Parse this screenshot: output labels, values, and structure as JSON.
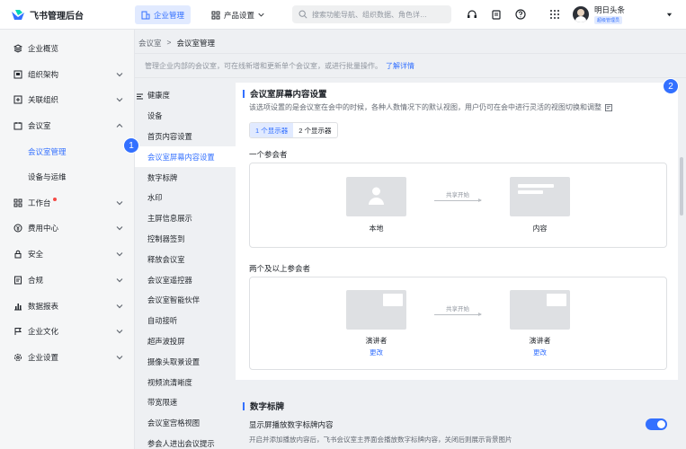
{
  "app": {
    "title": "飞书管理后台"
  },
  "top_nav": {
    "tabs": [
      {
        "label": "企业管理",
        "icon": "building-icon",
        "active": true
      },
      {
        "label": "产品设置",
        "icon": "settings-grid-icon",
        "active": false
      }
    ],
    "search_placeholder": "搜索功能导航、组织数据、角色详…"
  },
  "user": {
    "name": "明日头条",
    "badge": "超级管理员"
  },
  "sidebar": {
    "items": [
      {
        "label": "企业概览",
        "icon": "layers-icon",
        "chevron": false
      },
      {
        "label": "组织架构",
        "icon": "org-icon",
        "chevron": "down"
      },
      {
        "label": "关联组织",
        "icon": "link-icon",
        "chevron": "down"
      },
      {
        "label": "会议室",
        "icon": "calendar-icon",
        "chevron": "up"
      },
      {
        "label": "会议室管理",
        "sub": true,
        "active": true
      },
      {
        "label": "设备与运维",
        "sub": true
      },
      {
        "label": "工作台",
        "icon": "grid-icon",
        "chevron": "down",
        "dot": true
      },
      {
        "label": "费用中心",
        "icon": "yen-icon",
        "chevron": "down"
      },
      {
        "label": "安全",
        "icon": "lock-icon",
        "chevron": "down"
      },
      {
        "label": "合规",
        "icon": "doc-icon",
        "chevron": "down"
      },
      {
        "label": "数据报表",
        "icon": "chart-icon",
        "chevron": "down"
      },
      {
        "label": "企业文化",
        "icon": "flag-icon",
        "chevron": "down"
      },
      {
        "label": "企业设置",
        "icon": "gear-icon",
        "chevron": "down"
      }
    ]
  },
  "breadcrumb": {
    "parent": "会议室",
    "sep": ">",
    "current": "会议室管理"
  },
  "description": {
    "text": "管理企业内部的会议室，可在线新增和更新单个会议室，或进行批量操作。",
    "link": "了解详情"
  },
  "subnav": {
    "items": [
      "健康度",
      "设备",
      "首页内容设置",
      "会议室屏幕内容设置",
      "数字标牌",
      "水印",
      "主屏信息展示",
      "控制器签到",
      "释放会议室",
      "会议室遥控器",
      "会议室智能伙伴",
      "自动接听",
      "超声波投屏",
      "摄像头取景设置",
      "视频流清晰度",
      "带宽限速",
      "会议室宫格视图",
      "参会人进出会议提示"
    ],
    "active_index": 3
  },
  "panel": {
    "title": "会议室屏幕内容设置",
    "desc": "该选项设置的是会议室在会中的时候，各种人数情况下的默认视图，用户仍可在会中进行灵活的视图切换和调整",
    "segments": [
      "1 个显示器",
      "2 个显示器"
    ],
    "one": {
      "label": "一个参会者",
      "left_caption": "本地",
      "share": "共享开始",
      "right_caption": "内容"
    },
    "two": {
      "label": "两个及以上参会者",
      "left_caption": "演讲者",
      "left_change": "更改",
      "share": "共享开始",
      "right_caption": "演讲者",
      "right_change": "更改"
    }
  },
  "lower": {
    "title": "数字标牌",
    "item": "显示屏播放数字标牌内容",
    "desc": "开启并添加播放内容后，飞书会议室主界面会播放数字标牌内容，关闭后则展示背景图片",
    "toggle_on": true
  },
  "badges": [
    "1",
    "2"
  ],
  "colors": {
    "accent": "#3370ff",
    "sidebar_bg": "#f5f6f7",
    "danger": "#f54a45"
  }
}
